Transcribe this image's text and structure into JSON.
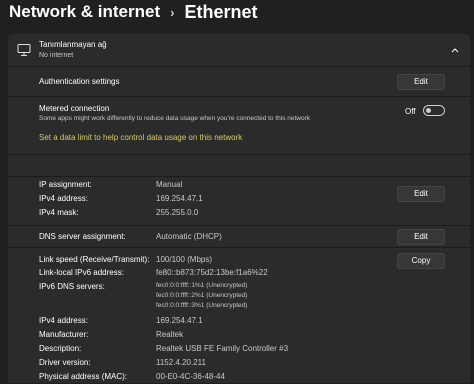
{
  "breadcrumb": {
    "parent": "Network & internet",
    "separator": "›",
    "current": "Ethernet"
  },
  "network": {
    "name": "Tanımlanmayan ağ",
    "status": "No internet",
    "icon": "ethernet-monitor-icon"
  },
  "auth": {
    "label": "Authentication settings",
    "button": "Edit"
  },
  "metered": {
    "label": "Metered connection",
    "description": "Some apps might work differently to reduce data usage when you're connected to this network",
    "toggle_state": "Off",
    "link": "Set a data limit to help control data usage on this network"
  },
  "ip": {
    "assignment_label": "IP assignment:",
    "assignment_value": "Manual",
    "ipv4_label": "IPv4 address:",
    "ipv4_value": "169.254.47.1",
    "mask_label": "IPv4 mask:",
    "mask_value": "255.255.0.0",
    "button": "Edit"
  },
  "dns": {
    "label": "DNS server assignment:",
    "value": "Automatic (DHCP)",
    "button": "Edit"
  },
  "props": {
    "button": "Copy",
    "link_speed_label": "Link speed (Receive/Transmit):",
    "link_speed_value": "100/100 (Mbps)",
    "ipv6_label": "Link-local IPv6 address:",
    "ipv6_value": "fe80::b873:75d2:13be:f1a6%22",
    "ipv6dns_label": "IPv6 DNS servers:",
    "ipv6dns_values": [
      "fec0:0:0:ffff::1%1 (Unencrypted)",
      "fec0:0:0:ffff::2%1 (Unencrypted)",
      "fec0:0:0:ffff::3%1 (Unencrypted)"
    ],
    "ipv4_label": "IPv4 address:",
    "ipv4_value": "169.254.47.1",
    "manufacturer_label": "Manufacturer:",
    "manufacturer_value": "Realtek",
    "description_label": "Description:",
    "description_value": "Realtek USB FE Family Controller #3",
    "driver_label": "Driver version:",
    "driver_value": "1152.4.20.211",
    "mac_label": "Physical address (MAC):",
    "mac_value": "00-E0-4C-36-48-44"
  }
}
